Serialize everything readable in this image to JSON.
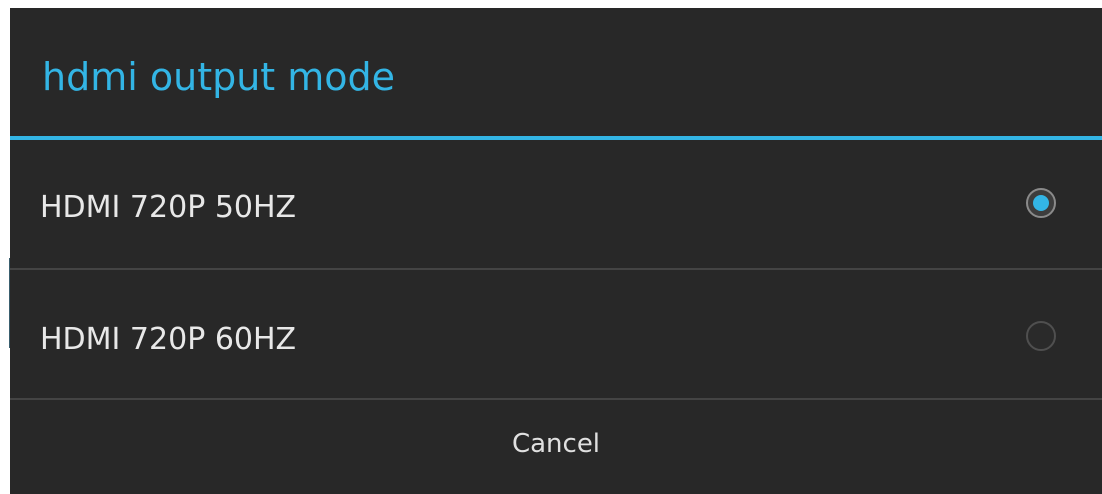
{
  "dialog": {
    "title": "hdmi output mode",
    "options": [
      {
        "label": "HDMI 720P 50HZ",
        "selected": true
      },
      {
        "label": "HDMI 720P 60HZ",
        "selected": false
      }
    ],
    "cancel_label": "Cancel"
  },
  "colors": {
    "accent": "#33b5e5",
    "background": "#282828",
    "text": "#e8e8e8",
    "divider": "#444444"
  },
  "icons": {
    "selected_radio": "radio-checked-icon",
    "unselected_radio": "radio-unchecked-icon"
  }
}
